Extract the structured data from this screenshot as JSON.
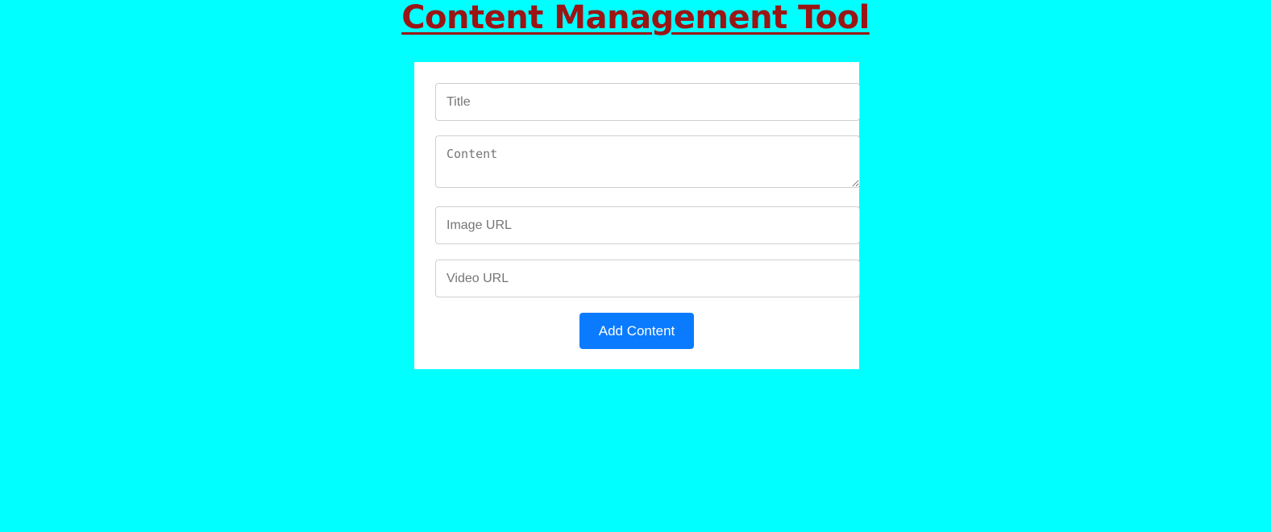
{
  "header": {
    "title": "Content Management Tool"
  },
  "form": {
    "title_placeholder": "Title",
    "content_placeholder": "Content",
    "image_url_placeholder": "Image URL",
    "video_url_placeholder": "Video URL",
    "submit_label": "Add Content"
  },
  "colors": {
    "background": "#00ffff",
    "title": "#9b1515",
    "button": "#0a7bff"
  }
}
